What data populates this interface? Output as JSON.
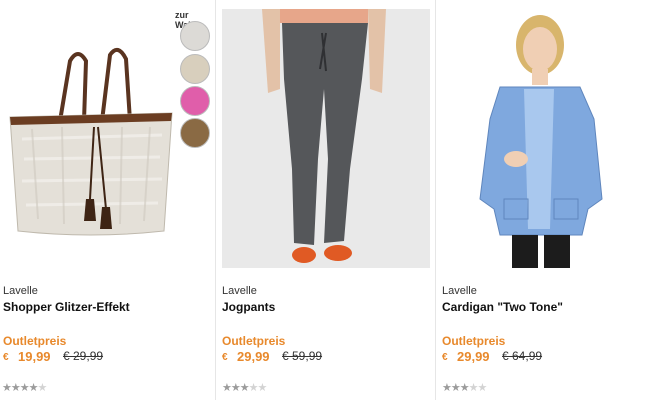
{
  "swatches_label": "zur Wahl",
  "swatch_colors": [
    "#dcdad6",
    "#d8cfbd",
    "#e05eaa",
    "#8a6a44"
  ],
  "accent_color": "#e8892c",
  "products": [
    {
      "brand": "Lavelle",
      "name": "Shopper Glitzer-Effekt",
      "price_label": "Outletpreis",
      "currency": "€",
      "price": "19,99",
      "old_price": "€ 29,99",
      "rating": 4,
      "rating_max": 5
    },
    {
      "brand": "Lavelle",
      "name": "Jogpants",
      "price_label": "Outletpreis",
      "currency": "€",
      "price": "29,99",
      "old_price": "€ 59,99",
      "rating": 3,
      "rating_max": 5
    },
    {
      "brand": "Lavelle",
      "name": "Cardigan \"Two Tone\"",
      "price_label": "Outletpreis",
      "currency": "€",
      "price": "29,99",
      "old_price": "€ 64,99",
      "rating": 3,
      "rating_max": 5
    }
  ]
}
